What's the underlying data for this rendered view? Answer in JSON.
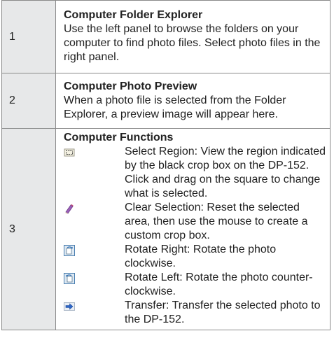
{
  "rows": [
    {
      "number": "1",
      "title": "Computer Folder Explorer",
      "text": "Use the left panel to browse the folders on your computer to find photo files. Select photo files in the right panel."
    },
    {
      "number": "2",
      "title": "Computer Photo Preview",
      "text": "When a photo file is selected from the Folder Explorer, a preview image will appear here."
    },
    {
      "number": "3",
      "title": "Computer Functions",
      "functions": [
        {
          "icon": "select-region-icon",
          "text": "Select Region: View the region indicated by the black crop box on the DP-152. Click and drag on the square to change what is selected."
        },
        {
          "icon": "clear-selection-icon",
          "text": "Clear Selection: Reset the se­lected area, then use the mouse to create a custom crop box."
        },
        {
          "icon": "rotate-right-icon",
          "text": "Rotate Right: Rotate the photo clockwise."
        },
        {
          "icon": "rotate-left-icon",
          "text": "Rotate Left: Rotate the photo counter-clockwise."
        },
        {
          "icon": "transfer-icon",
          "text": "Transfer: Transfer the selected photo to the DP-152."
        }
      ]
    }
  ]
}
